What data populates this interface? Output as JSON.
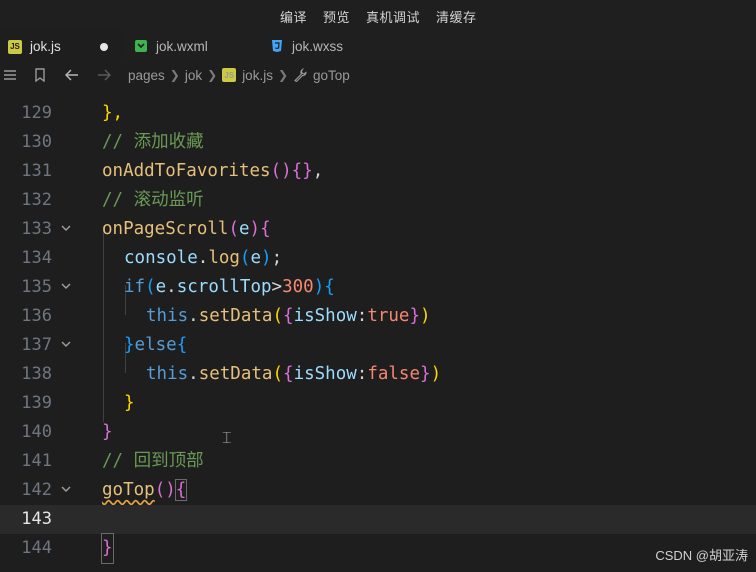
{
  "topbar": {
    "menu": [
      "编译",
      "预览",
      "真机调试",
      "清缓存"
    ]
  },
  "tabs": [
    {
      "label": "jok.js",
      "icon": "js-file-icon",
      "active": true,
      "modified": true
    },
    {
      "label": "jok.wxml",
      "icon": "wxml-file-icon",
      "active": false
    },
    {
      "label": "jok.wxss",
      "icon": "css-file-icon",
      "active": false
    }
  ],
  "breadcrumb": {
    "items": [
      "pages",
      "jok",
      "jok.js",
      "goTop"
    ]
  },
  "editor": {
    "current_line": "143",
    "lines": [
      {
        "n": "129",
        "text": "},"
      },
      {
        "n": "130",
        "text": "// 添加收藏"
      },
      {
        "n": "131",
        "text": "onAddToFavorites(){},"
      },
      {
        "n": "132",
        "text": "// 滚动监听"
      },
      {
        "n": "133",
        "text": "onPageScroll(e){"
      },
      {
        "n": "134",
        "text": "console.log(e);"
      },
      {
        "n": "135",
        "text": "if(e.scrollTop>300){"
      },
      {
        "n": "136",
        "text": "this.setData({isShow:true})"
      },
      {
        "n": "137",
        "text": "}else{"
      },
      {
        "n": "138",
        "text": "this.setData({isShow:false})"
      },
      {
        "n": "139",
        "text": "}"
      },
      {
        "n": "140",
        "text": "}"
      },
      {
        "n": "141",
        "text": "// 回到顶部"
      },
      {
        "n": "142",
        "text": "goTop(){"
      },
      {
        "n": "143",
        "text": ""
      },
      {
        "n": "144",
        "text": "}"
      }
    ]
  },
  "watermark": "CSDN @胡亚涛"
}
